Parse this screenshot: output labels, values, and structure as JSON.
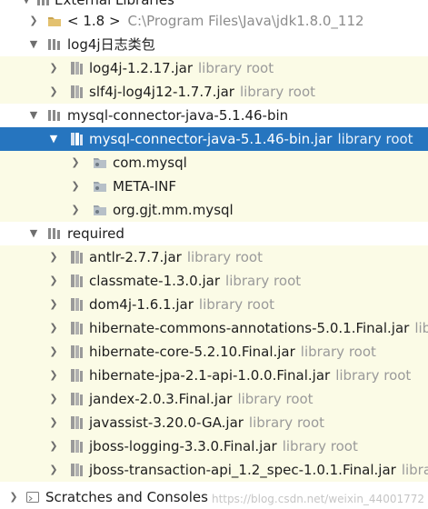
{
  "tree": {
    "top_label": "External Libraries",
    "jdk": {
      "label": "< 1.8 >",
      "path": "C:\\Program Files\\Java\\jdk1.8.0_112"
    },
    "lib_log4j": {
      "label": "log4j日志类包",
      "jars": [
        {
          "name": "log4j-1.2.17.jar",
          "hint": "library root"
        },
        {
          "name": "slf4j-log4j12-1.7.7.jar",
          "hint": "library root"
        }
      ]
    },
    "lib_mysql": {
      "label": "mysql-connector-java-5.1.46-bin",
      "jar": {
        "name": "mysql-connector-java-5.1.46-bin.jar",
        "hint": "library root"
      },
      "packages": [
        "com.mysql",
        "META-INF",
        "org.gjt.mm.mysql"
      ]
    },
    "lib_required": {
      "label": "required",
      "jars": [
        {
          "name": "antlr-2.7.7.jar",
          "hint": "library root"
        },
        {
          "name": "classmate-1.3.0.jar",
          "hint": "library root"
        },
        {
          "name": "dom4j-1.6.1.jar",
          "hint": "library root"
        },
        {
          "name": "hibernate-commons-annotations-5.0.1.Final.jar",
          "hint": "lib"
        },
        {
          "name": "hibernate-core-5.2.10.Final.jar",
          "hint": "library root"
        },
        {
          "name": "hibernate-jpa-2.1-api-1.0.0.Final.jar",
          "hint": "library root"
        },
        {
          "name": "jandex-2.0.3.Final.jar",
          "hint": "library root"
        },
        {
          "name": "javassist-3.20.0-GA.jar",
          "hint": "library root"
        },
        {
          "name": "jboss-logging-3.3.0.Final.jar",
          "hint": "library root"
        },
        {
          "name": "jboss-transaction-api_1.2_spec-1.0.1.Final.jar",
          "hint": "librar"
        }
      ]
    },
    "scratches": {
      "label": "Scratches and Consoles"
    }
  },
  "watermark": "https://blog.csdn.net/weixin_44001772",
  "colors": {
    "selection": "#2675bf",
    "row_alt": "#fbfbe6",
    "hint": "#9a9a9a"
  }
}
